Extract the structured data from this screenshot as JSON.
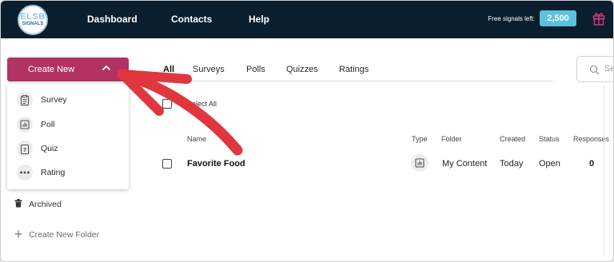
{
  "logo": {
    "line1": "ELSB",
    "line2": "SIGNALS"
  },
  "nav": {
    "dashboard": "Dashboard",
    "contacts": "Contacts",
    "help": "Help"
  },
  "signals": {
    "label": "Free signals left:",
    "count": "2,500"
  },
  "create_button": {
    "label": "Create New"
  },
  "dropdown": {
    "items": [
      {
        "label": "Survey",
        "icon": "survey-icon"
      },
      {
        "label": "Poll",
        "icon": "poll-icon"
      },
      {
        "label": "Quiz",
        "icon": "quiz-icon"
      },
      {
        "label": "Rating",
        "icon": "rating-icon"
      }
    ]
  },
  "sidebar": {
    "archived": "Archived",
    "create_folder": "Create New Folder"
  },
  "tabs": [
    "All",
    "Surveys",
    "Polls",
    "Quizzes",
    "Ratings"
  ],
  "active_tab": "All",
  "search": {
    "placeholder": "Se"
  },
  "table": {
    "select_all": "Select All",
    "columns": {
      "name": "Name",
      "type": "Type",
      "folder": "Folder",
      "created": "Created",
      "status": "Status",
      "responses": "Responses"
    },
    "rows": [
      {
        "name": "Favorite Food",
        "type_icon": "poll-icon",
        "folder": "My Content",
        "created": "Today",
        "status": "Open",
        "responses": "0"
      }
    ]
  },
  "colors": {
    "topbar": "#0b1e2d",
    "brand": "#b23261",
    "accent": "#5cc2db",
    "arrow": "#e0373f",
    "gift": "#d63b7e"
  }
}
